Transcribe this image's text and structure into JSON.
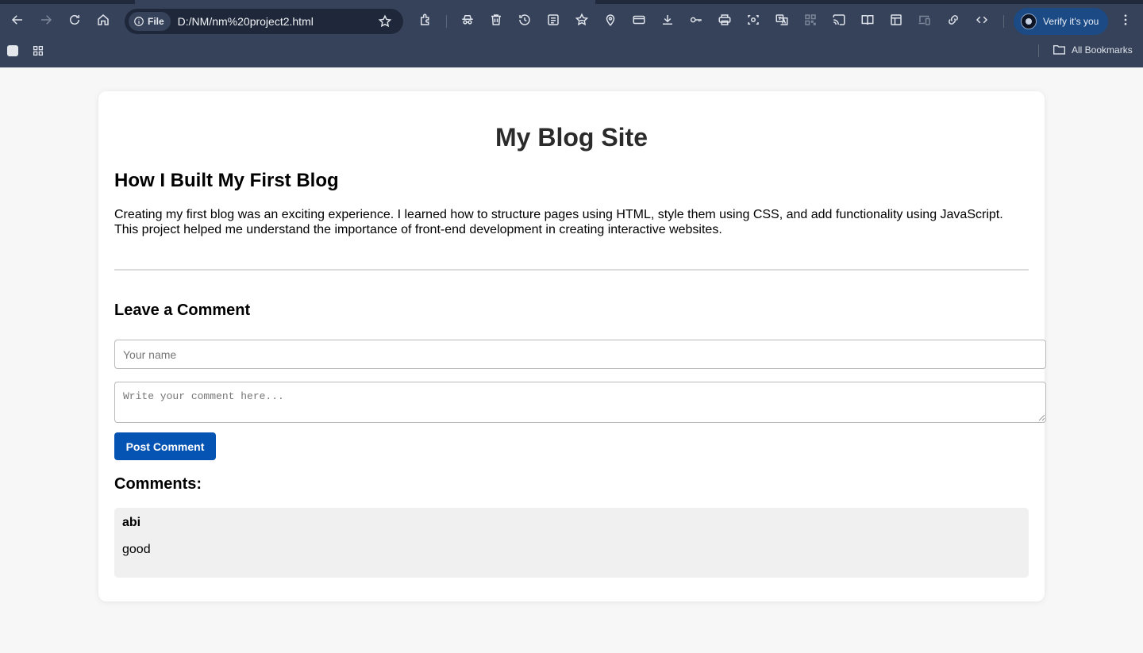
{
  "browser": {
    "url_chip": "File",
    "url": "D:/NM/nm%20project2.html",
    "profile_label": "Verify it's you",
    "bookmarks_label": "All Bookmarks",
    "toolbar_icons": [
      "back-icon",
      "forward-icon",
      "reload-icon",
      "home-icon",
      "info-icon",
      "bookmark-star-icon",
      "extensions-icon",
      "incognito-icon",
      "delete-icon",
      "history-icon",
      "reading-list-icon",
      "favorites-icon",
      "location-icon",
      "payment-card-icon",
      "download-icon",
      "key-icon",
      "print-icon",
      "screenshot-icon",
      "translate-icon",
      "qr-code-icon",
      "cast-icon",
      "reading-mode-icon",
      "side-panel-icon",
      "devices-icon",
      "link-icon",
      "code-icon",
      "more-icon"
    ]
  },
  "page": {
    "site_title": "My Blog Site",
    "post": {
      "title": "How I Built My First Blog",
      "body": "Creating my first blog was an exciting experience. I learned how to structure pages using HTML, style them using CSS, and add functionality using JavaScript. This project helped me understand the importance of front-end development in creating interactive websites."
    },
    "comment_form": {
      "heading": "Leave a Comment",
      "name_placeholder": "Your name",
      "name_value": "",
      "comment_placeholder": "Write your comment here...",
      "comment_value": "",
      "submit_label": "Post Comment"
    },
    "comments_heading": "Comments:",
    "comments": [
      {
        "author": "abi",
        "text": "good"
      }
    ]
  },
  "colors": {
    "chrome_bg": "#35425a",
    "omnibox_bg": "#1f283a",
    "profile_bg": "#1c4a85",
    "page_bg": "#f7f7f7",
    "button_bg": "#0553b2",
    "comment_bg": "#f0f0f0"
  }
}
